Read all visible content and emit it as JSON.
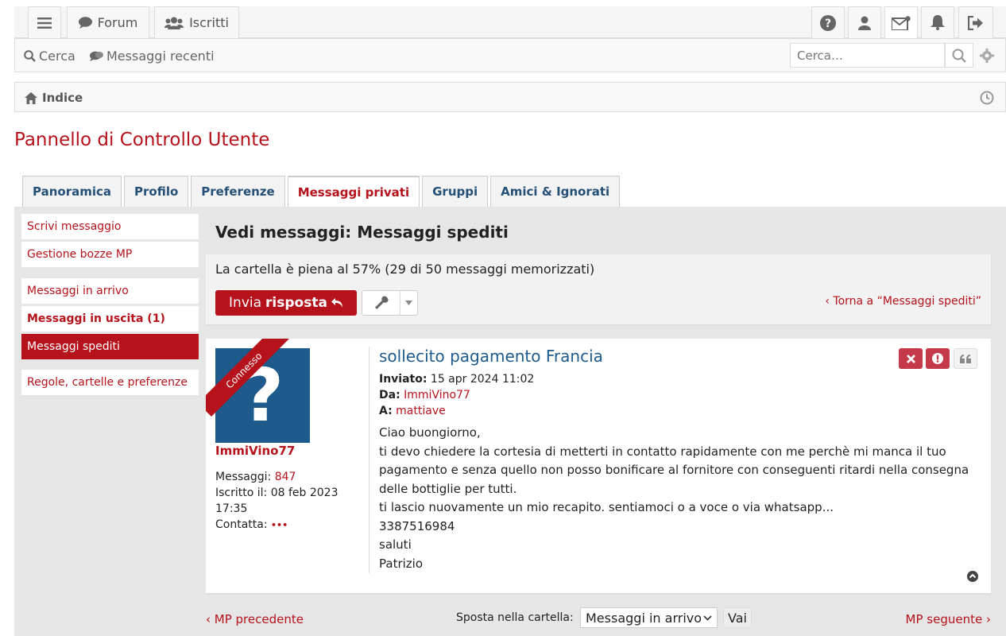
{
  "navbar": {
    "forum_label": "Forum",
    "members_label": "Iscritti"
  },
  "searchbar": {
    "search_label": "Cerca",
    "recent_label": "Messaggi recenti",
    "search_placeholder": "Cerca…"
  },
  "breadcrumb": {
    "home": "Indice"
  },
  "page_title": "Pannello di Controllo Utente",
  "tabs": [
    {
      "label": "Panoramica",
      "active": false
    },
    {
      "label": "Profilo",
      "active": false
    },
    {
      "label": "Preferenze",
      "active": false
    },
    {
      "label": "Messaggi privati",
      "active": true
    },
    {
      "label": "Gruppi",
      "active": false
    },
    {
      "label": "Amici & Ignorati",
      "active": false
    }
  ],
  "sidebar": {
    "items": [
      {
        "label": "Scrivi messaggio"
      },
      {
        "label": "Gestione bozze MP"
      },
      {
        "label": "Messaggi in arrivo"
      },
      {
        "label": "Messaggi in uscita (1)"
      },
      {
        "label": "Messaggi spediti"
      },
      {
        "label": "Regole, cartelle e preferenze"
      }
    ]
  },
  "view": {
    "title": "Vedi messaggi: Messaggi spediti",
    "folder_status": "La cartella è piena al 57% (29 di 50 messaggi memorizzati)",
    "reply_pre": "Invia",
    "reply_bold": "risposta",
    "back_link": "‹ Torna a “Messaggi spediti”"
  },
  "post": {
    "online_ribbon": "Connesso",
    "author": "ImmiVino77",
    "posts_label": "Messaggi:",
    "posts_count": "847",
    "joined_label": "Iscritto il:",
    "joined_date": "08 feb 2023 17:35",
    "contact_label": "Contatta:",
    "contact_dots": "•••",
    "subject": "sollecito pagamento Francia",
    "sent_label": "Inviato:",
    "sent_date": "15 apr 2024 11:02",
    "from_label": "Da:",
    "from_user": "ImmiVino77",
    "to_label": "A:",
    "to_user": "mattiave",
    "body_lines": [
      "Ciao buongiorno,",
      "ti devo chiedere la cortesia di metterti in contatto rapidamente con me perchè mi manca il tuo",
      "pagamento e senza quello non posso bonificare al fornitore con conseguenti ritardi nella consegna",
      "delle bottiglie per tutti.",
      "ti lascio nuovamente un mio recapito. sentiamoci o a voce o via whatsapp...",
      "3387516984",
      "saluti",
      "Patrizio"
    ]
  },
  "bottom": {
    "prev": "‹ MP precedente",
    "next": "MP seguente ›",
    "move_label": "Sposta nella cartella:",
    "move_value": "Messaggi in arrivo",
    "go": "Vai"
  },
  "colors": {
    "brand_red": "#b5121b",
    "link_blue": "#245078",
    "avatar_blue": "#1e5a8c"
  }
}
